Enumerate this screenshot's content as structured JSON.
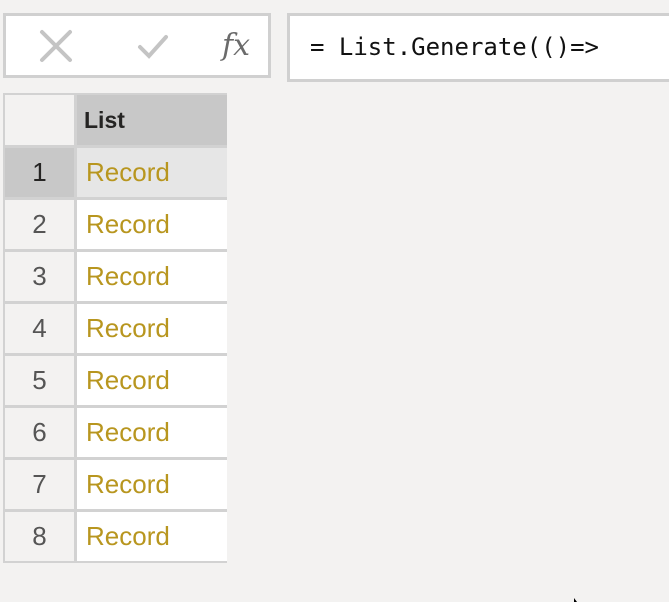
{
  "formula_bar": {
    "cancel_icon": "close-icon",
    "commit_icon": "checkmark-icon",
    "insert_function_label": "fx",
    "formula": "= List.Generate(()=>"
  },
  "table": {
    "columns": [
      "List"
    ],
    "selected_row": 1,
    "rows": [
      {
        "num": "1",
        "value": "Record"
      },
      {
        "num": "2",
        "value": "Record"
      },
      {
        "num": "3",
        "value": "Record"
      },
      {
        "num": "4",
        "value": "Record"
      },
      {
        "num": "5",
        "value": "Record"
      },
      {
        "num": "6",
        "value": "Record"
      },
      {
        "num": "7",
        "value": "Record"
      },
      {
        "num": "8",
        "value": "Record"
      }
    ]
  },
  "colors": {
    "record_link": "#b8961f",
    "header_bg": "#c8c8c8",
    "background": "#f3f2f1"
  }
}
